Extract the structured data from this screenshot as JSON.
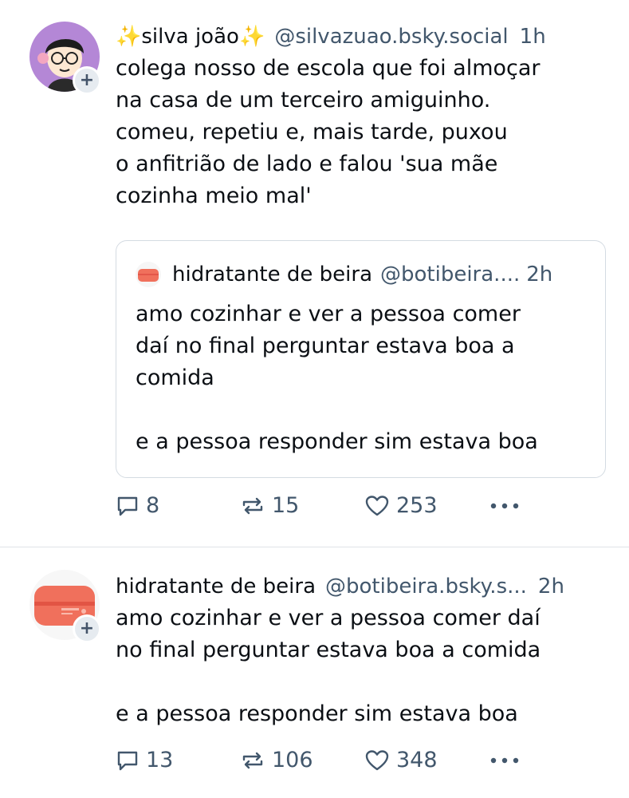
{
  "posts": [
    {
      "author": {
        "sparkle_left": "✨",
        "name": "silva joão",
        "sparkle_right": "✨",
        "handle": "@silvazuao.bsky.social",
        "time": "1h",
        "avatar_icon": "cartoon-person-avatar-icon"
      },
      "text": "colega nosso de escola que foi almoçar\nna casa de um terceiro amiguinho.\ncomeu, repetiu e, mais tarde, puxou\no anfitrião de lado e falou 'sua mãe\ncozinha meio mal'",
      "quote": {
        "name": "hidratante de beira",
        "handle": "@botibeira....",
        "time": "2h",
        "text": "amo cozinhar e ver a pessoa comer\ndaí no final perguntar estava boa a\ncomida\n\ne a pessoa responder sim estava boa"
      },
      "stats": {
        "replies": "8",
        "reposts": "15",
        "likes": "253"
      }
    },
    {
      "author": {
        "name": "hidratante de beira",
        "handle": "@botibeira.bsky.s...",
        "time": "2h",
        "avatar_icon": "cream-jar-avatar-icon"
      },
      "text": "amo cozinhar e ver a pessoa comer daí\nno final perguntar estava boa a comida\n\ne a pessoa responder sim estava boa",
      "stats": {
        "replies": "13",
        "reposts": "106",
        "likes": "348"
      }
    }
  ],
  "colors": {
    "text": "#0b0f14",
    "muted": "#42576c",
    "border": "#d4dbe2",
    "badge": "#e6ebf0",
    "jar": "#f0705c"
  },
  "icons": {
    "follow": "+",
    "reply": "reply-icon",
    "repost": "repost-icon",
    "like": "heart-icon",
    "more": "more-icon"
  }
}
